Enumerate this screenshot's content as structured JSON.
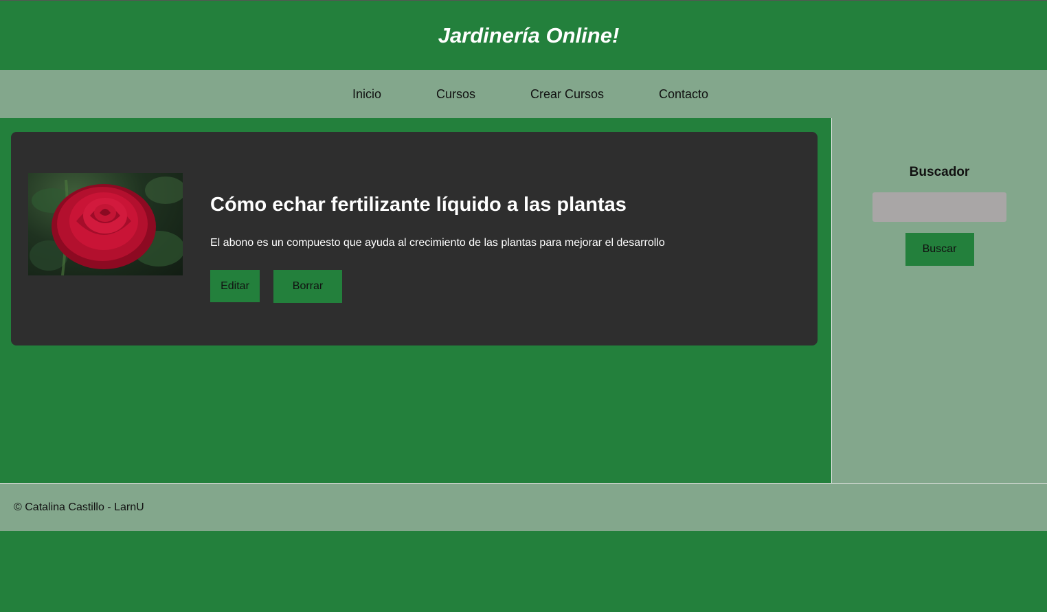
{
  "header": {
    "title": "Jardinería Online!"
  },
  "nav": {
    "items": [
      {
        "label": "Inicio"
      },
      {
        "label": "Cursos"
      },
      {
        "label": "Crear Cursos"
      },
      {
        "label": "Contacto"
      }
    ]
  },
  "card": {
    "image_icon": "rose-image",
    "title": "Cómo echar fertilizante líquido a las plantas",
    "description": "El abono es un compuesto que ayuda al crecimiento de las plantas para mejorar el desarrollo",
    "edit_label": "Editar",
    "delete_label": "Borrar"
  },
  "sidebar": {
    "title": "Buscador",
    "search_value": "",
    "search_button_label": "Buscar"
  },
  "footer": {
    "text": "© Catalina Castillo - LarnU"
  },
  "colors": {
    "primary_green": "#23803c",
    "light_green": "#83a78c",
    "card_background": "#2e2e2e",
    "input_gray": "#a9a6a6"
  }
}
